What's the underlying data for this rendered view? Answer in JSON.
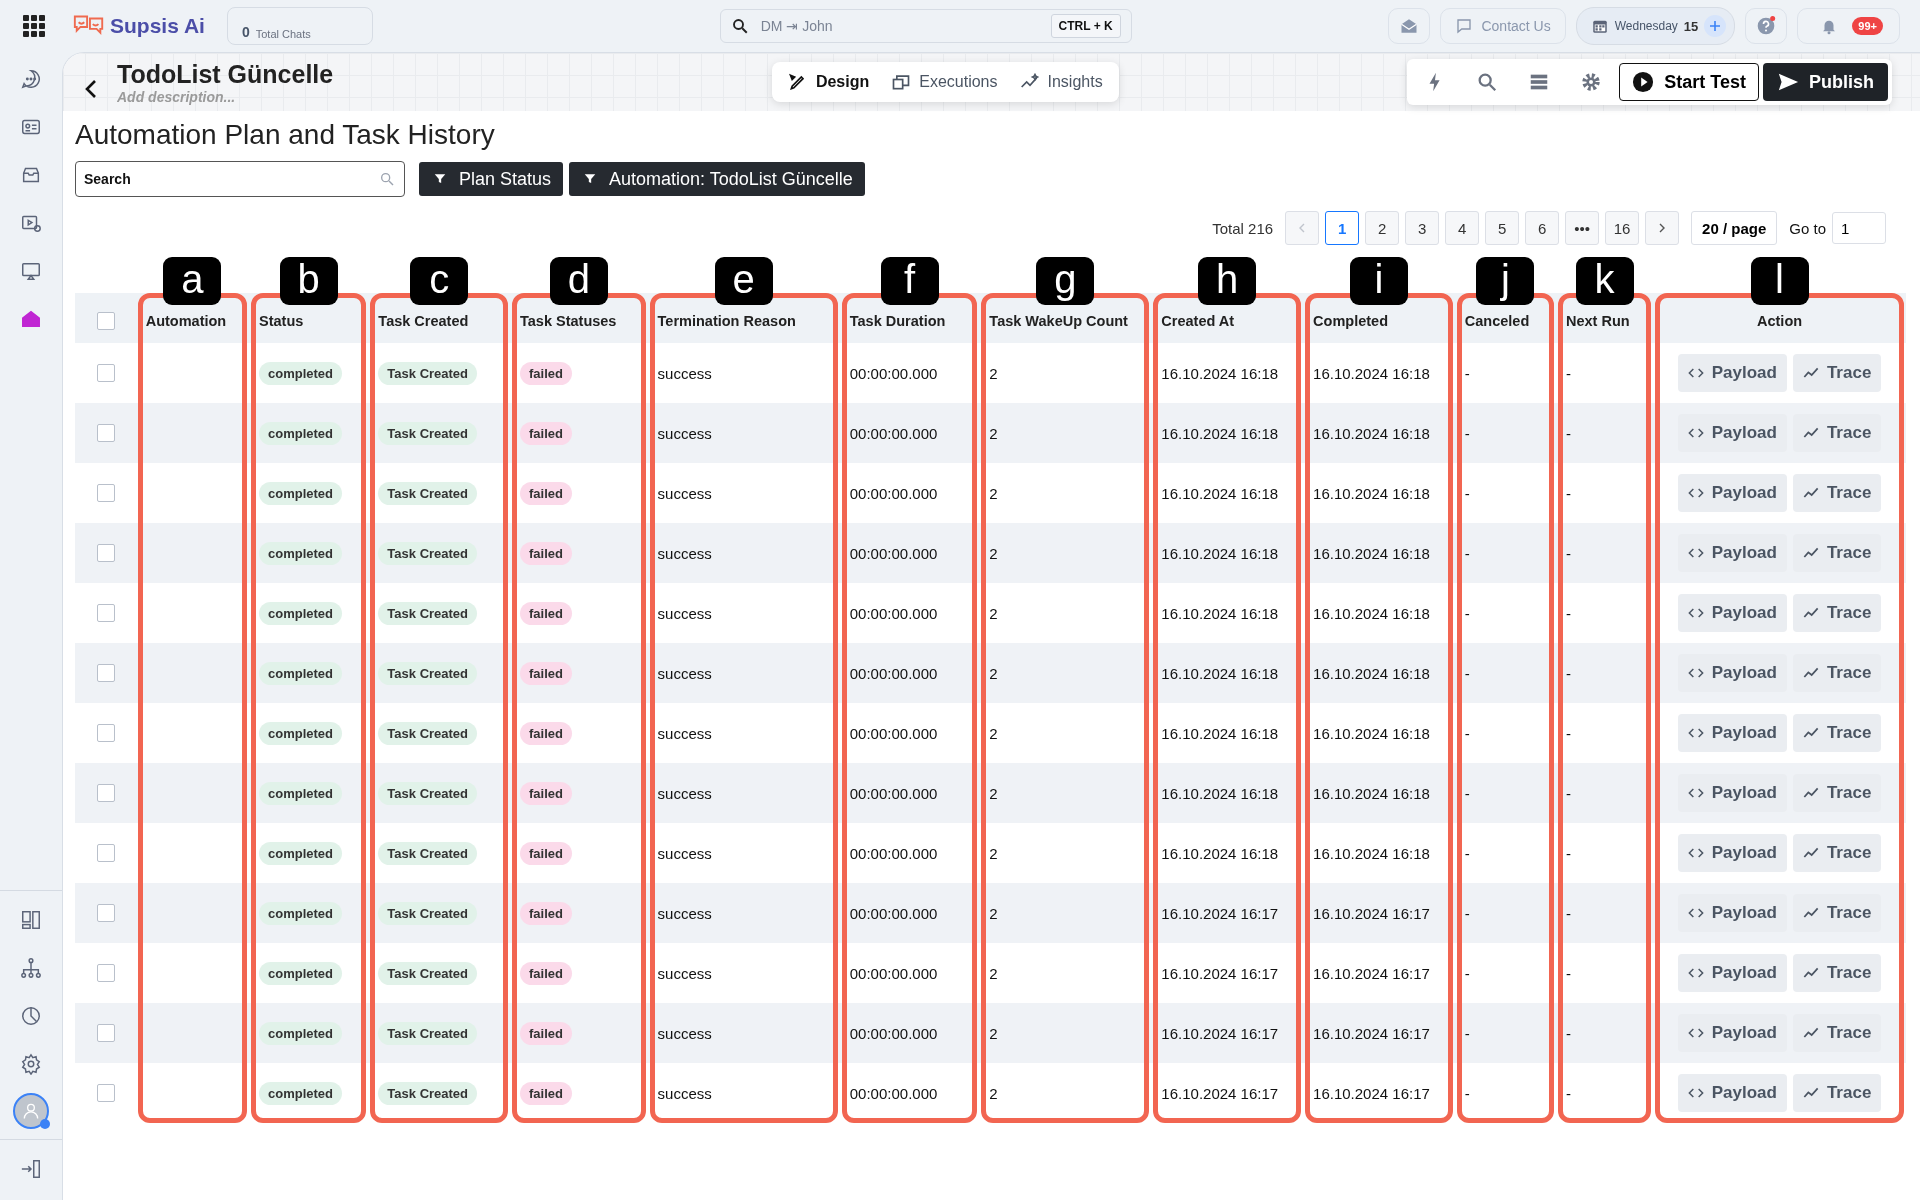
{
  "top_bar": {
    "brand": "Supsis Ai",
    "total_chats": {
      "count": "0",
      "label": "Total Chats"
    },
    "search": {
      "value": "DM ⇥ John",
      "shortcut": "CTRL + K"
    },
    "contact_button": "Contact Us",
    "date": {
      "day": "Wednesday",
      "number": "15"
    },
    "notification_badge": "99+"
  },
  "sidebar": {
    "items": [
      {
        "selected": false
      },
      {
        "selected": false
      },
      {
        "selected": false
      },
      {
        "selected": false
      },
      {
        "selected": false
      },
      {
        "selected": true
      }
    ]
  },
  "editor_header": {
    "title": "TodoList Güncelle",
    "description": {
      "placeholder": "Add description..."
    },
    "modes": [
      {
        "label": "Design",
        "selected": true
      },
      {
        "label": "Executions",
        "selected": false
      },
      {
        "label": "Insights",
        "selected": false
      }
    ],
    "start_test": "Start Test",
    "publish": "Publish"
  },
  "page": {
    "title": "Automation Plan and Task History",
    "search": {
      "placeholder": "Search"
    },
    "filters": [
      "Plan Status",
      "Automation: TodoList Güncelle"
    ]
  },
  "pagination": {
    "total": "Total 216",
    "pages": [
      {
        "label": "1",
        "selected": true
      },
      {
        "label": "2",
        "selected": false
      },
      {
        "label": "3",
        "selected": false
      },
      {
        "label": "4",
        "selected": false
      },
      {
        "label": "5",
        "selected": false
      },
      {
        "label": "6",
        "selected": false
      },
      {
        "label": "•••",
        "selected": false
      },
      {
        "label": "16",
        "selected": false
      }
    ],
    "page_size": "20 / page",
    "goto_label": "Go to",
    "goto_value": "1"
  },
  "table": {
    "select_all_checked": false,
    "columns": [
      {
        "label": "Automation",
        "marker": "a",
        "kind": "text"
      },
      {
        "label": "Status",
        "marker": "b",
        "kind": "tag"
      },
      {
        "label": "Task Created",
        "marker": "c",
        "kind": "tag"
      },
      {
        "label": "Task Statuses",
        "marker": "d",
        "kind": "alert"
      },
      {
        "label": "Termination Reason",
        "marker": "e",
        "kind": "text"
      },
      {
        "label": "Task Duration",
        "marker": "f",
        "kind": "text"
      },
      {
        "label": "Task WakeUp Count",
        "marker": "g",
        "kind": "text"
      },
      {
        "label": "Created At",
        "marker": "h",
        "kind": "text"
      },
      {
        "label": "Completed",
        "marker": "i",
        "kind": "text"
      },
      {
        "label": "Canceled",
        "marker": "j",
        "kind": "text"
      },
      {
        "label": "Next Run",
        "marker": "k",
        "kind": "text"
      },
      {
        "label": "Action",
        "marker": "l",
        "kind": "actions"
      }
    ],
    "rows": [
      {
        "checked": false,
        "cells": [
          "",
          "completed",
          "Task Created",
          "failed",
          "success",
          "00:00:00.000",
          "2",
          "16.10.2024 16:18",
          "16.10.2024 16:18",
          "-",
          "-"
        ],
        "actions": [
          "Payload",
          "Trace"
        ]
      },
      {
        "checked": false,
        "cells": [
          "",
          "completed",
          "Task Created",
          "failed",
          "success",
          "00:00:00.000",
          "2",
          "16.10.2024 16:18",
          "16.10.2024 16:18",
          "-",
          "-"
        ],
        "actions": [
          "Payload",
          "Trace"
        ]
      },
      {
        "checked": false,
        "cells": [
          "",
          "completed",
          "Task Created",
          "failed",
          "success",
          "00:00:00.000",
          "2",
          "16.10.2024 16:18",
          "16.10.2024 16:18",
          "-",
          "-"
        ],
        "actions": [
          "Payload",
          "Trace"
        ]
      },
      {
        "checked": false,
        "cells": [
          "",
          "completed",
          "Task Created",
          "failed",
          "success",
          "00:00:00.000",
          "2",
          "16.10.2024 16:18",
          "16.10.2024 16:18",
          "-",
          "-"
        ],
        "actions": [
          "Payload",
          "Trace"
        ]
      },
      {
        "checked": false,
        "cells": [
          "",
          "completed",
          "Task Created",
          "failed",
          "success",
          "00:00:00.000",
          "2",
          "16.10.2024 16:18",
          "16.10.2024 16:18",
          "-",
          "-"
        ],
        "actions": [
          "Payload",
          "Trace"
        ]
      },
      {
        "checked": false,
        "cells": [
          "",
          "completed",
          "Task Created",
          "failed",
          "success",
          "00:00:00.000",
          "2",
          "16.10.2024 16:18",
          "16.10.2024 16:18",
          "-",
          "-"
        ],
        "actions": [
          "Payload",
          "Trace"
        ]
      },
      {
        "checked": false,
        "cells": [
          "",
          "completed",
          "Task Created",
          "failed",
          "success",
          "00:00:00.000",
          "2",
          "16.10.2024 16:18",
          "16.10.2024 16:18",
          "-",
          "-"
        ],
        "actions": [
          "Payload",
          "Trace"
        ]
      },
      {
        "checked": false,
        "cells": [
          "",
          "completed",
          "Task Created",
          "failed",
          "success",
          "00:00:00.000",
          "2",
          "16.10.2024 16:18",
          "16.10.2024 16:18",
          "-",
          "-"
        ],
        "actions": [
          "Payload",
          "Trace"
        ]
      },
      {
        "checked": false,
        "cells": [
          "",
          "completed",
          "Task Created",
          "failed",
          "success",
          "00:00:00.000",
          "2",
          "16.10.2024 16:18",
          "16.10.2024 16:18",
          "-",
          "-"
        ],
        "actions": [
          "Payload",
          "Trace"
        ]
      },
      {
        "checked": false,
        "cells": [
          "",
          "completed",
          "Task Created",
          "failed",
          "success",
          "00:00:00.000",
          "2",
          "16.10.2024 16:17",
          "16.10.2024 16:17",
          "-",
          "-"
        ],
        "actions": [
          "Payload",
          "Trace"
        ]
      },
      {
        "checked": false,
        "cells": [
          "",
          "completed",
          "Task Created",
          "failed",
          "success",
          "00:00:00.000",
          "2",
          "16.10.2024 16:17",
          "16.10.2024 16:17",
          "-",
          "-"
        ],
        "actions": [
          "Payload",
          "Trace"
        ]
      },
      {
        "checked": false,
        "cells": [
          "",
          "completed",
          "Task Created",
          "failed",
          "success",
          "00:00:00.000",
          "2",
          "16.10.2024 16:17",
          "16.10.2024 16:17",
          "-",
          "-"
        ],
        "actions": [
          "Payload",
          "Trace"
        ]
      },
      {
        "checked": false,
        "cells": [
          "",
          "completed",
          "Task Created",
          "failed",
          "success",
          "00:00:00.000",
          "2",
          "16.10.2024 16:17",
          "16.10.2024 16:17",
          "-",
          "-"
        ],
        "actions": [
          "Payload",
          "Trace"
        ]
      }
    ]
  }
}
